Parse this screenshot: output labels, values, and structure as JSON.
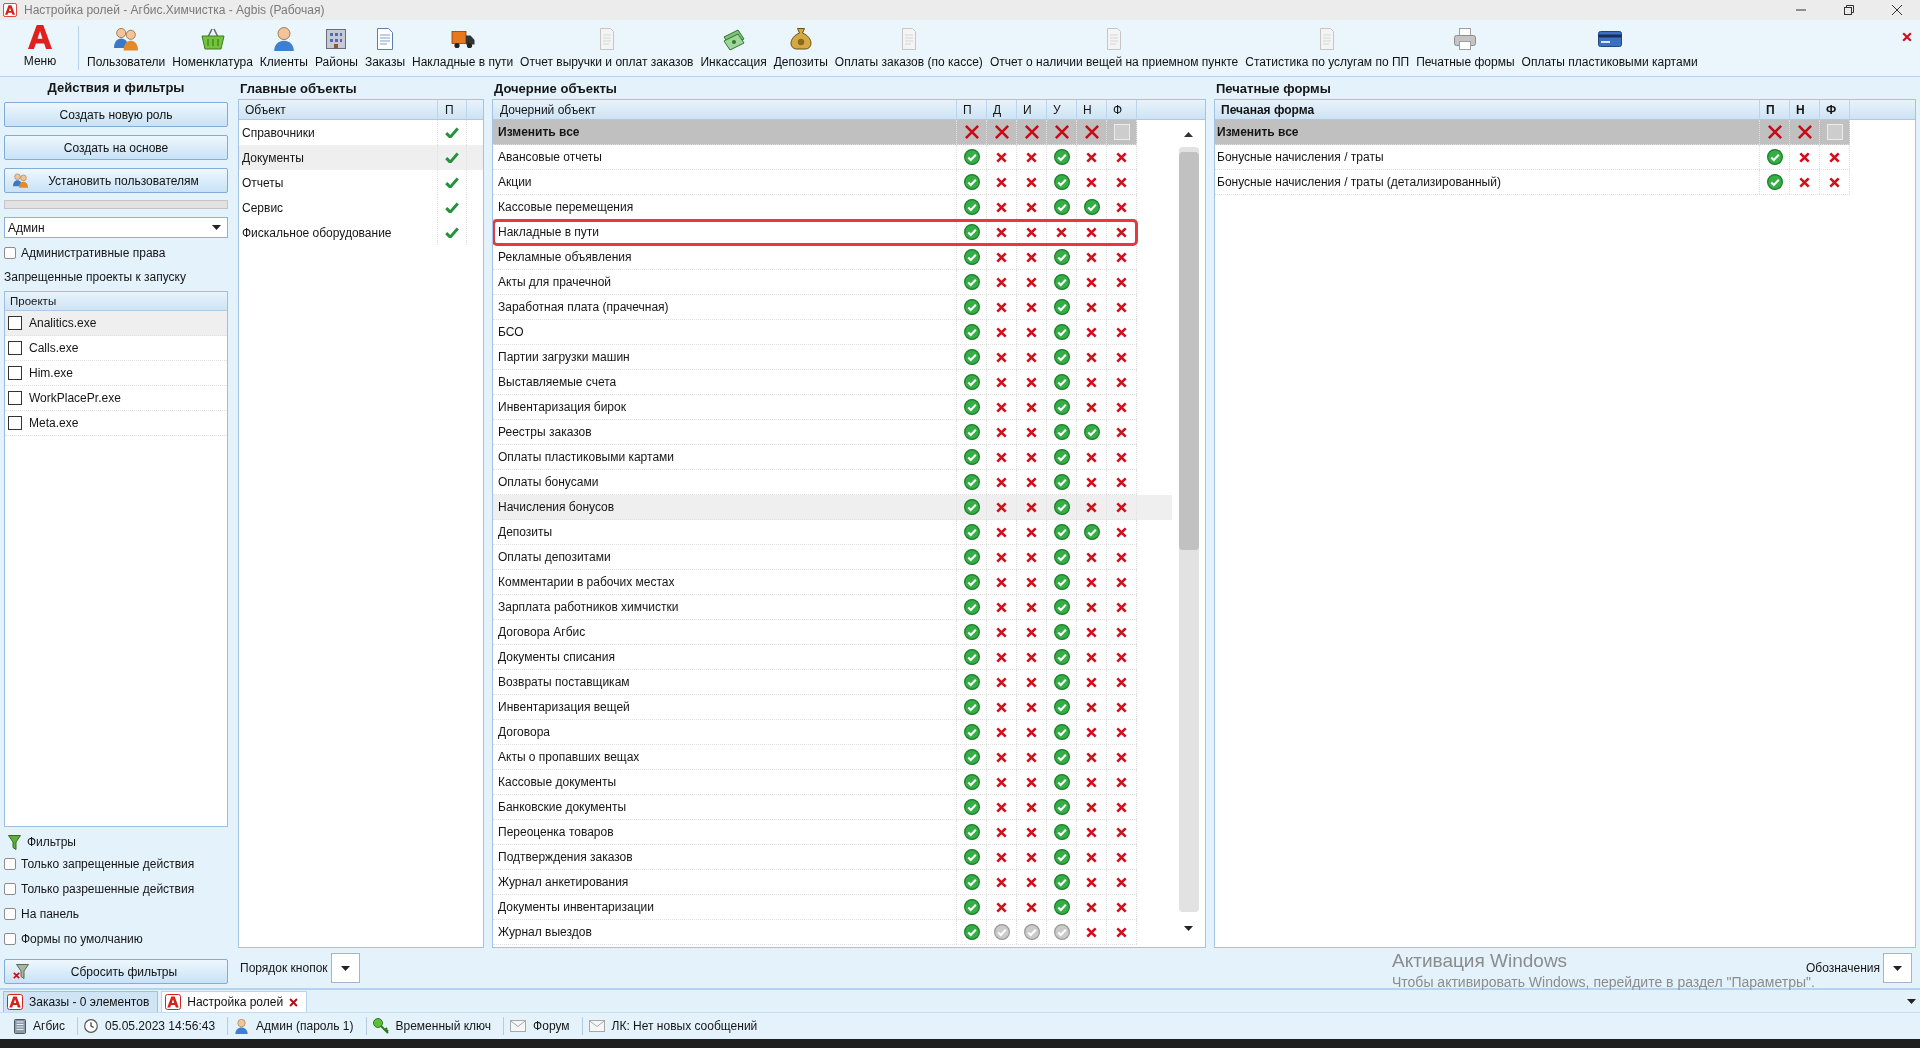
{
  "window": {
    "title": "Настройка ролей - Агбис.Химчистка - Agbis (Рабочая)"
  },
  "toolbar": {
    "menu": "Меню",
    "items": [
      "Пользователи",
      "Номенклатура",
      "Клиенты",
      "Районы",
      "Заказы",
      "Накладные в пути",
      "Отчет выручки и оплат заказов",
      "Инкассация",
      "Депозиты",
      "Оплаты заказов (по кассе)",
      "Отчет о наличии вещей на приемном пункте",
      "Статистика по услугам по ПП",
      "Печатные формы",
      "Оплаты пластиковыми картами"
    ]
  },
  "actions_panel": {
    "title": "Действия и фильтры",
    "buttons": [
      {
        "label": "Создать новую роль",
        "with_icon": false
      },
      {
        "label": "Создать на основе",
        "with_icon": false
      },
      {
        "label": "Установить пользователям",
        "with_icon": true
      }
    ],
    "role": "Админ",
    "admin_rights": {
      "label": "Административные права",
      "checked": false
    },
    "forbidden_projects": {
      "title": "Запрещенные проекты к запуску",
      "column": "Проекты",
      "items": [
        {
          "name": "Analitics.exe",
          "checked": false,
          "selected": true
        },
        {
          "name": "Calls.exe",
          "checked": false,
          "selected": false
        },
        {
          "name": "Him.exe",
          "checked": false,
          "selected": false
        },
        {
          "name": "WorkPlacePr.exe",
          "checked": false,
          "selected": false
        },
        {
          "name": "Meta.exe",
          "checked": false,
          "selected": false
        }
      ]
    },
    "filters": {
      "title": "Фильтры",
      "options": [
        {
          "label": "Только запрещенные действия",
          "checked": false
        },
        {
          "label": "Только разрешенные действия",
          "checked": false
        },
        {
          "label": "На панель",
          "checked": false
        },
        {
          "label": "Формы по умолчанию",
          "checked": false
        }
      ],
      "reset_button": "Сбросить фильтры"
    }
  },
  "main_objects": {
    "title": "Главные объекты",
    "columns": [
      "Объект",
      "П"
    ],
    "rows": [
      {
        "name": "Справочники",
        "allowed": true,
        "selected": false
      },
      {
        "name": "Документы",
        "allowed": true,
        "selected": true
      },
      {
        "name": "Отчеты",
        "allowed": true,
        "selected": false
      },
      {
        "name": "Сервис",
        "allowed": true,
        "selected": false
      },
      {
        "name": "Фискальное оборудование",
        "allowed": true,
        "selected": false
      }
    ]
  },
  "child_objects": {
    "title": "Дочерние объекты",
    "columns": [
      "Дочерний объект",
      "П",
      "Д",
      "И",
      "У",
      "Н",
      "Ф"
    ],
    "change_all": {
      "label": "Изменить все",
      "cells": [
        {
          "kind": "toggle",
          "granted": false
        },
        {
          "kind": "toggle",
          "granted": false
        },
        {
          "kind": "toggle",
          "granted": false
        },
        {
          "kind": "toggle",
          "granted": false
        },
        {
          "kind": "toggle",
          "granted": false
        },
        {
          "kind": "checkbox",
          "checked": false
        }
      ]
    },
    "rows": [
      {
        "name": "Авансовые отчеты",
        "granted": [
          true,
          false,
          false,
          true,
          false,
          false
        ],
        "disabled": [
          false,
          false,
          false,
          false,
          false,
          false
        ],
        "highlighted": false,
        "marked": false
      },
      {
        "name": "Акции",
        "granted": [
          true,
          false,
          false,
          true,
          false,
          false
        ],
        "disabled": [
          false,
          false,
          false,
          false,
          false,
          false
        ],
        "highlighted": false,
        "marked": false
      },
      {
        "name": "Кассовые перемещения",
        "granted": [
          true,
          false,
          false,
          true,
          true,
          false
        ],
        "disabled": [
          false,
          false,
          false,
          false,
          false,
          false
        ],
        "highlighted": false,
        "marked": false
      },
      {
        "name": "Накладные в пути",
        "granted": [
          true,
          false,
          false,
          false,
          false,
          false
        ],
        "disabled": [
          false,
          false,
          false,
          false,
          false,
          false
        ],
        "highlighted": false,
        "marked": true
      },
      {
        "name": "Рекламные объявления",
        "granted": [
          true,
          false,
          false,
          true,
          false,
          false
        ],
        "disabled": [
          false,
          false,
          false,
          false,
          false,
          false
        ],
        "highlighted": false,
        "marked": false
      },
      {
        "name": "Акты для прачечной",
        "granted": [
          true,
          false,
          false,
          true,
          false,
          false
        ],
        "disabled": [
          false,
          false,
          false,
          false,
          false,
          false
        ],
        "highlighted": false,
        "marked": false
      },
      {
        "name": "Заработная плата (прачечная)",
        "granted": [
          true,
          false,
          false,
          true,
          false,
          false
        ],
        "disabled": [
          false,
          false,
          false,
          false,
          false,
          false
        ],
        "highlighted": false,
        "marked": false
      },
      {
        "name": "БСО",
        "granted": [
          true,
          false,
          false,
          true,
          false,
          false
        ],
        "disabled": [
          false,
          false,
          false,
          false,
          false,
          false
        ],
        "highlighted": false,
        "marked": false
      },
      {
        "name": "Партии загрузки машин",
        "granted": [
          true,
          false,
          false,
          true,
          false,
          false
        ],
        "disabled": [
          false,
          false,
          false,
          false,
          false,
          false
        ],
        "highlighted": false,
        "marked": false
      },
      {
        "name": "Выставляемые счета",
        "granted": [
          true,
          false,
          false,
          true,
          false,
          false
        ],
        "disabled": [
          false,
          false,
          false,
          false,
          false,
          false
        ],
        "highlighted": false,
        "marked": false
      },
      {
        "name": "Инвентаризация бирок",
        "granted": [
          true,
          false,
          false,
          true,
          false,
          false
        ],
        "disabled": [
          false,
          false,
          false,
          false,
          false,
          false
        ],
        "highlighted": false,
        "marked": false
      },
      {
        "name": "Реестры заказов",
        "granted": [
          true,
          false,
          false,
          true,
          true,
          false
        ],
        "disabled": [
          false,
          false,
          false,
          false,
          false,
          false
        ],
        "highlighted": false,
        "marked": false
      },
      {
        "name": "Оплаты пластиковыми картами",
        "granted": [
          true,
          false,
          false,
          true,
          false,
          false
        ],
        "disabled": [
          false,
          false,
          false,
          false,
          false,
          false
        ],
        "highlighted": false,
        "marked": false
      },
      {
        "name": "Оплаты бонусами",
        "granted": [
          true,
          false,
          false,
          true,
          false,
          false
        ],
        "disabled": [
          false,
          false,
          false,
          false,
          false,
          false
        ],
        "highlighted": false,
        "marked": false
      },
      {
        "name": "Начисления бонусов",
        "granted": [
          true,
          false,
          false,
          true,
          false,
          false
        ],
        "disabled": [
          false,
          false,
          false,
          false,
          false,
          false
        ],
        "highlighted": true,
        "marked": false
      },
      {
        "name": "Депозиты",
        "granted": [
          true,
          false,
          false,
          true,
          true,
          false
        ],
        "disabled": [
          false,
          false,
          false,
          false,
          false,
          false
        ],
        "highlighted": false,
        "marked": false
      },
      {
        "name": "Оплаты депозитами",
        "granted": [
          true,
          false,
          false,
          true,
          false,
          false
        ],
        "disabled": [
          false,
          false,
          false,
          false,
          false,
          false
        ],
        "highlighted": false,
        "marked": false
      },
      {
        "name": "Комментарии в рабочих местах",
        "granted": [
          true,
          false,
          false,
          true,
          false,
          false
        ],
        "disabled": [
          false,
          false,
          false,
          false,
          false,
          false
        ],
        "highlighted": false,
        "marked": false
      },
      {
        "name": "Зарплата работников химчистки",
        "granted": [
          true,
          false,
          false,
          true,
          false,
          false
        ],
        "disabled": [
          false,
          false,
          false,
          false,
          false,
          false
        ],
        "highlighted": false,
        "marked": false
      },
      {
        "name": "Договора Агбис",
        "granted": [
          true,
          false,
          false,
          true,
          false,
          false
        ],
        "disabled": [
          false,
          false,
          false,
          false,
          false,
          false
        ],
        "highlighted": false,
        "marked": false
      },
      {
        "name": "Документы списания",
        "granted": [
          true,
          false,
          false,
          true,
          false,
          false
        ],
        "disabled": [
          false,
          false,
          false,
          false,
          false,
          false
        ],
        "highlighted": false,
        "marked": false
      },
      {
        "name": "Возвраты поставщикам",
        "granted": [
          true,
          false,
          false,
          true,
          false,
          false
        ],
        "disabled": [
          false,
          false,
          false,
          false,
          false,
          false
        ],
        "highlighted": false,
        "marked": false
      },
      {
        "name": "Инвентаризация вещей",
        "granted": [
          true,
          false,
          false,
          true,
          false,
          false
        ],
        "disabled": [
          false,
          false,
          false,
          false,
          false,
          false
        ],
        "highlighted": false,
        "marked": false
      },
      {
        "name": "Договора",
        "granted": [
          true,
          false,
          false,
          true,
          false,
          false
        ],
        "disabled": [
          false,
          false,
          false,
          false,
          false,
          false
        ],
        "highlighted": false,
        "marked": false
      },
      {
        "name": "Акты о пропавших вещах",
        "granted": [
          true,
          false,
          false,
          true,
          false,
          false
        ],
        "disabled": [
          false,
          false,
          false,
          false,
          false,
          false
        ],
        "highlighted": false,
        "marked": false
      },
      {
        "name": "Кассовые документы",
        "granted": [
          true,
          false,
          false,
          true,
          false,
          false
        ],
        "disabled": [
          false,
          false,
          false,
          false,
          false,
          false
        ],
        "highlighted": false,
        "marked": false
      },
      {
        "name": "Банковские документы",
        "granted": [
          true,
          false,
          false,
          true,
          false,
          false
        ],
        "disabled": [
          false,
          false,
          false,
          false,
          false,
          false
        ],
        "highlighted": false,
        "marked": false
      },
      {
        "name": "Переоценка товаров",
        "granted": [
          true,
          false,
          false,
          true,
          false,
          false
        ],
        "disabled": [
          false,
          false,
          false,
          false,
          false,
          false
        ],
        "highlighted": false,
        "marked": false
      },
      {
        "name": "Подтверждения заказов",
        "granted": [
          true,
          false,
          false,
          true,
          false,
          false
        ],
        "disabled": [
          false,
          false,
          false,
          false,
          false,
          false
        ],
        "highlighted": false,
        "marked": false
      },
      {
        "name": "Журнал анкетирования",
        "granted": [
          true,
          false,
          false,
          true,
          false,
          false
        ],
        "disabled": [
          false,
          false,
          false,
          false,
          false,
          false
        ],
        "highlighted": false,
        "marked": false
      },
      {
        "name": "Документы инвентаризации",
        "granted": [
          true,
          false,
          false,
          true,
          false,
          false
        ],
        "disabled": [
          false,
          false,
          false,
          false,
          false,
          false
        ],
        "highlighted": false,
        "marked": false
      },
      {
        "name": "Журнал выездов",
        "granted": [
          true,
          true,
          true,
          true,
          false,
          false
        ],
        "disabled": [
          false,
          true,
          true,
          true,
          false,
          false
        ],
        "highlighted": false,
        "marked": false
      }
    ]
  },
  "print_forms": {
    "title": "Печатные формы",
    "columns": [
      "Печаная форма",
      "П",
      "Н",
      "Ф"
    ],
    "change_all": {
      "label": "Изменить все",
      "cells": [
        {
          "kind": "toggle",
          "granted": false
        },
        {
          "kind": "toggle",
          "granted": false
        },
        {
          "kind": "checkbox",
          "checked": false
        }
      ]
    },
    "rows": [
      {
        "name": "Бонусные начисления / траты",
        "granted": [
          true,
          false,
          false
        ]
      },
      {
        "name": "Бонусные начисления / траты (детализированный)",
        "granted": [
          true,
          false,
          false
        ]
      }
    ]
  },
  "button_order": {
    "label": "Порядок кнопок"
  },
  "legend": {
    "label": "Обозначения"
  },
  "activation_notice": {
    "title": "Активация Windows",
    "text": "Чтобы активировать Windows, перейдите в раздел \"Параметры\"."
  },
  "tabs": [
    {
      "label": "Заказы - 0 элементов",
      "selected": false,
      "closable": false
    },
    {
      "label": "Настройка ролей",
      "selected": true,
      "closable": true
    }
  ],
  "status_bar": [
    "Агбис",
    "05.05.2023 14:56:43",
    "Админ (пароль 1)",
    "Временный ключ",
    "Форум",
    "ЛК: Нет новых сообщений"
  ]
}
